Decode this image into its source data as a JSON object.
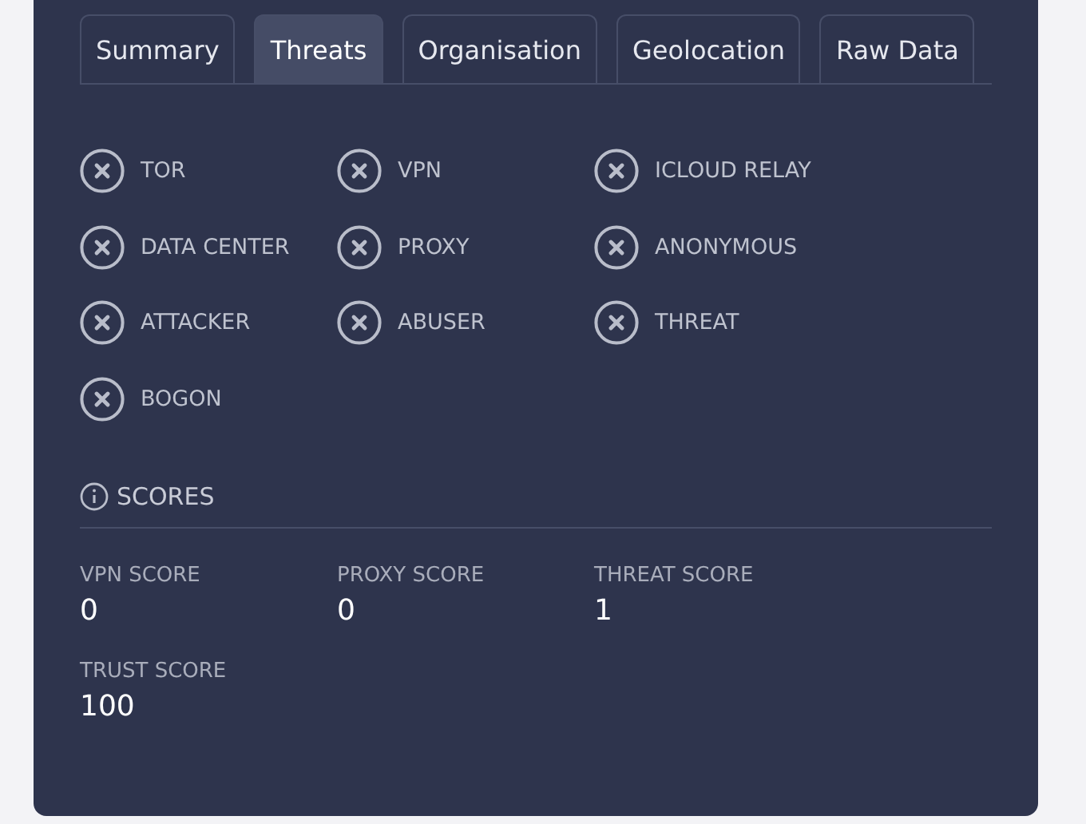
{
  "tabs": [
    {
      "label": "Summary",
      "selected": false
    },
    {
      "label": "Threats",
      "selected": true
    },
    {
      "label": "Organisation",
      "selected": false
    },
    {
      "label": "Geolocation",
      "selected": false
    },
    {
      "label": "Raw Data",
      "selected": false
    }
  ],
  "flags": [
    {
      "label": "TOR",
      "detected": false
    },
    {
      "label": "VPN",
      "detected": false
    },
    {
      "label": "ICLOUD RELAY",
      "detected": false
    },
    {
      "label": "DATA CENTER",
      "detected": false
    },
    {
      "label": "PROXY",
      "detected": false
    },
    {
      "label": "ANONYMOUS",
      "detected": false
    },
    {
      "label": "ATTACKER",
      "detected": false
    },
    {
      "label": "ABUSER",
      "detected": false
    },
    {
      "label": "THREAT",
      "detected": false
    },
    {
      "label": "BOGON",
      "detected": false
    }
  ],
  "scores": {
    "title": "SCORES",
    "items": [
      {
        "label": "VPN SCORE",
        "value": "0"
      },
      {
        "label": "PROXY SCORE",
        "value": "0"
      },
      {
        "label": "THREAT SCORE",
        "value": "1"
      },
      {
        "label": "TRUST SCORE",
        "value": "100"
      }
    ]
  }
}
